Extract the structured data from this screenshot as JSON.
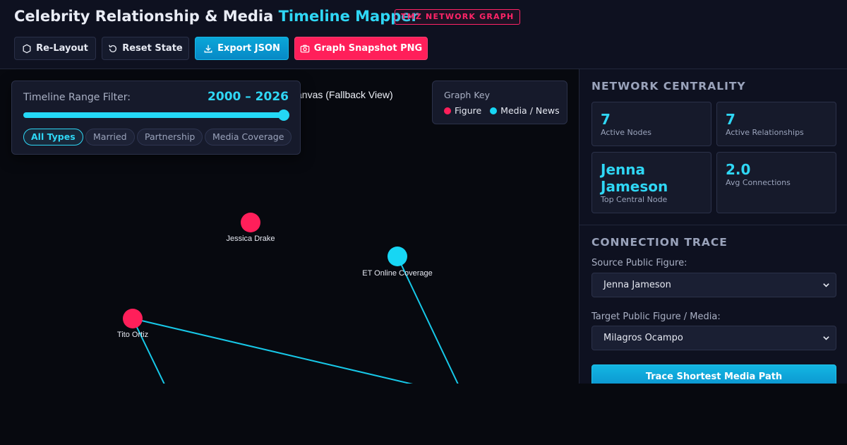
{
  "header": {
    "title_main": "Celebrity Relationship & Media",
    "title_accent": "Timeline Mapper",
    "badge": "TMZ NETWORK GRAPH"
  },
  "toolbar": {
    "relayout_label": "Re-Layout",
    "reset_label": "Reset State",
    "export_label": "Export JSON",
    "snapshot_label": "Graph Snapshot PNG"
  },
  "canvas": {
    "fallback_label": "anvas (Fallback View)"
  },
  "filter": {
    "label": "Timeline Range Filter:",
    "range_text": "2000 – 2026",
    "range_min": 2000,
    "range_max": 2026,
    "chips": [
      "All Types",
      "Married",
      "Partnership",
      "Media Coverage"
    ],
    "active_chip": "All Types"
  },
  "graph_key": {
    "title": "Graph Key",
    "items": [
      {
        "label": "Figure",
        "color": "#ff1f5a"
      },
      {
        "label": "Media / News",
        "color": "#17d6f4"
      }
    ]
  },
  "graph": {
    "nodes": [
      {
        "id": "jessica-drake",
        "label": "Jessica Drake",
        "type": "figure"
      },
      {
        "id": "et-online",
        "label": "ET Online Coverage",
        "type": "media"
      },
      {
        "id": "tito-ortiz",
        "label": "Tito Ortiz",
        "type": "figure"
      }
    ]
  },
  "centrality": {
    "title": "NETWORK CENTRALITY",
    "active_nodes_value": "7",
    "active_nodes_label": "Active Nodes",
    "active_rel_value": "7",
    "active_rel_label": "Active Relationships",
    "top_node_value_line1": "Jenna",
    "top_node_value_line2": "Jameson",
    "top_node_label": "Top Central Node",
    "avg_value": "2.0",
    "avg_label": "Avg Connections"
  },
  "trace": {
    "title": "CONNECTION TRACE",
    "source_label": "Source Public Figure:",
    "source_value": "Jenna Jameson",
    "target_label": "Target Public Figure / Media:",
    "target_value": "Milagros Ocampo",
    "button_label": "Trace Shortest Media Path"
  },
  "colors": {
    "accent": "#2fd7f5",
    "figure": "#ff1f5a",
    "media": "#17d6f4"
  }
}
